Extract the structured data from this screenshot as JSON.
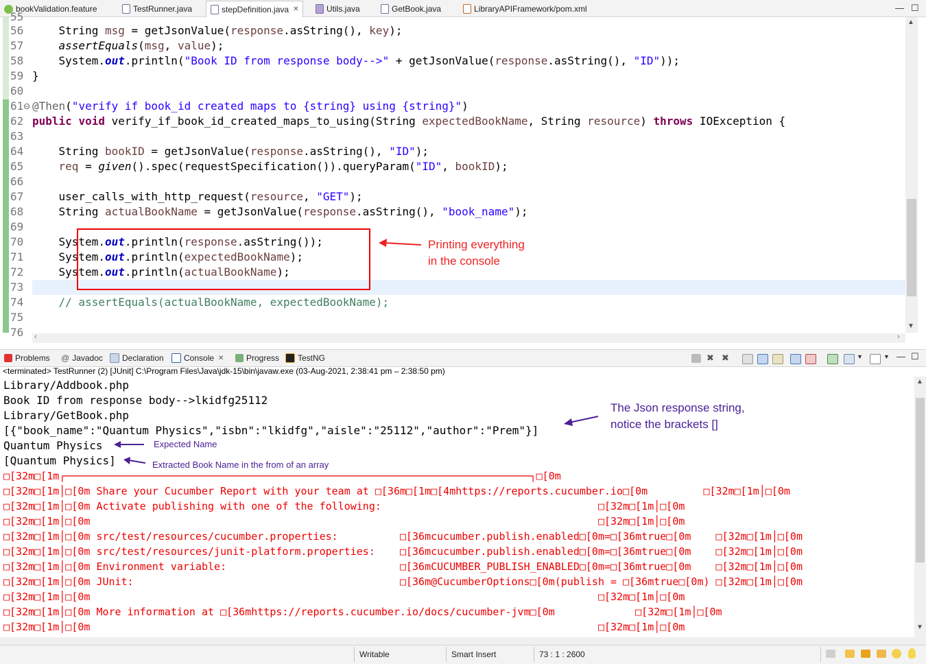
{
  "editor_tabs": [
    {
      "label": "bookValidation.feature",
      "icon": "feature-file-icon"
    },
    {
      "label": "TestRunner.java",
      "icon": "java-file-icon"
    },
    {
      "label": "stepDefinition.java",
      "icon": "java-file-icon"
    },
    {
      "label": "Utils.java",
      "icon": "java-file-icon"
    },
    {
      "label": "GetBook.java",
      "icon": "java-file-icon"
    },
    {
      "label": "LibraryAPIFramework/pom.xml",
      "icon": "xml-file-icon"
    }
  ],
  "code_lines": {
    "l55": "55",
    "l56": "56",
    "l57": "57",
    "l58": "58",
    "l59": "59",
    "l60": "60",
    "l61": "61⊖",
    "l62": "62",
    "l63": "63",
    "l64": "64",
    "l65": "65",
    "l66": "66",
    "l67": "67",
    "l68": "68",
    "l69": "69",
    "l70": "70",
    "l71": "71",
    "l72": "72",
    "l73": "73",
    "l74": "74",
    "l75": "75",
    "l76": "76"
  },
  "annotations": {
    "printing_note_line1": "Printing everything",
    "printing_note_line2": "in the console",
    "json_note_line1": "The Json response string,",
    "json_note_line2": "notice the brackets []",
    "expected_note": "Expected Name",
    "extracted_note": "Extracted Book Name in the from of an array"
  },
  "view_tabs": [
    {
      "label": "Problems",
      "icon": "problems-icon"
    },
    {
      "label": "Javadoc",
      "icon": "javadoc-icon"
    },
    {
      "label": "Declaration",
      "icon": "declaration-icon"
    },
    {
      "label": "Console",
      "icon": "console-icon",
      "active": true
    },
    {
      "label": "Progress",
      "icon": "progress-icon"
    },
    {
      "label": "TestNG",
      "icon": "testng-icon"
    }
  ],
  "terminated": "<terminated> TestRunner (2) [JUnit] C:\\Program Files\\Java\\jdk-15\\bin\\javaw.exe  (03-Aug-2021, 2:38:41 pm – 2:38:50 pm)",
  "console": {
    "c1": "Library/Addbook.php",
    "c2": "Book ID from response body-->lkidfg25112",
    "c3": "Library/GetBook.php",
    "c4": "[{\"book_name\":\"Quantum Physics\",\"isbn\":\"lkidfg\",\"aisle\":\"25112\",\"author\":\"Prem\"}]",
    "c5": "Quantum Physics",
    "c6": "[Quantum Physics]",
    "r1": "\u0000[32m\u0000[1m┌───────────────────────────────────────────────────────────────────────────┐\u0000[0m",
    "r2": "\u0000[32m\u0000[1m│\u0000[0m Share your Cucumber Report with your team at \u0000[36m\u0000[1m\u0000[4mhttps://reports.cucumber.io\u0000[0m         \u0000[32m\u0000[1m│\u0000[0m",
    "r3": "\u0000[32m\u0000[1m│\u0000[0m Activate publishing with one of the following:                                   \u0000[32m\u0000[1m│\u0000[0m",
    "r4": "\u0000[32m\u0000[1m│\u0000[0m                                                                                  \u0000[32m\u0000[1m│\u0000[0m",
    "r5": "\u0000[32m\u0000[1m│\u0000[0m src/test/resources/cucumber.properties:          \u0000[36mcucumber.publish.enabled\u0000[0m=\u0000[36mtrue\u0000[0m    \u0000[32m\u0000[1m│\u0000[0m",
    "r6": "\u0000[32m\u0000[1m│\u0000[0m src/test/resources/junit-platform.properties:    \u0000[36mcucumber.publish.enabled\u0000[0m=\u0000[36mtrue\u0000[0m    \u0000[32m\u0000[1m│\u0000[0m",
    "r7": "\u0000[32m\u0000[1m│\u0000[0m Environment variable:                            \u0000[36mCUCUMBER_PUBLISH_ENABLED\u0000[0m=\u0000[36mtrue\u0000[0m    \u0000[32m\u0000[1m│\u0000[0m",
    "r8": "\u0000[32m\u0000[1m│\u0000[0m JUnit:                                           \u0000[36m@CucumberOptions\u0000[0m(publish = \u0000[36mtrue\u0000[0m) \u0000[32m\u0000[1m│\u0000[0m",
    "r9": "\u0000[32m\u0000[1m│\u0000[0m                                                                                  \u0000[32m\u0000[1m│\u0000[0m",
    "r10": "\u0000[32m\u0000[1m│\u0000[0m More information at \u0000[36mhttps://reports.cucumber.io/docs/cucumber-jvm\u0000[0m             \u0000[32m\u0000[1m│\u0000[0m",
    "r11": "\u0000[32m\u0000[1m│\u0000[0m                                                                                  \u0000[32m\u0000[1m│\u0000[0m"
  },
  "status": {
    "writable": "Writable",
    "insert_mode": "Smart Insert",
    "position": "73 : 1 : 2600"
  }
}
